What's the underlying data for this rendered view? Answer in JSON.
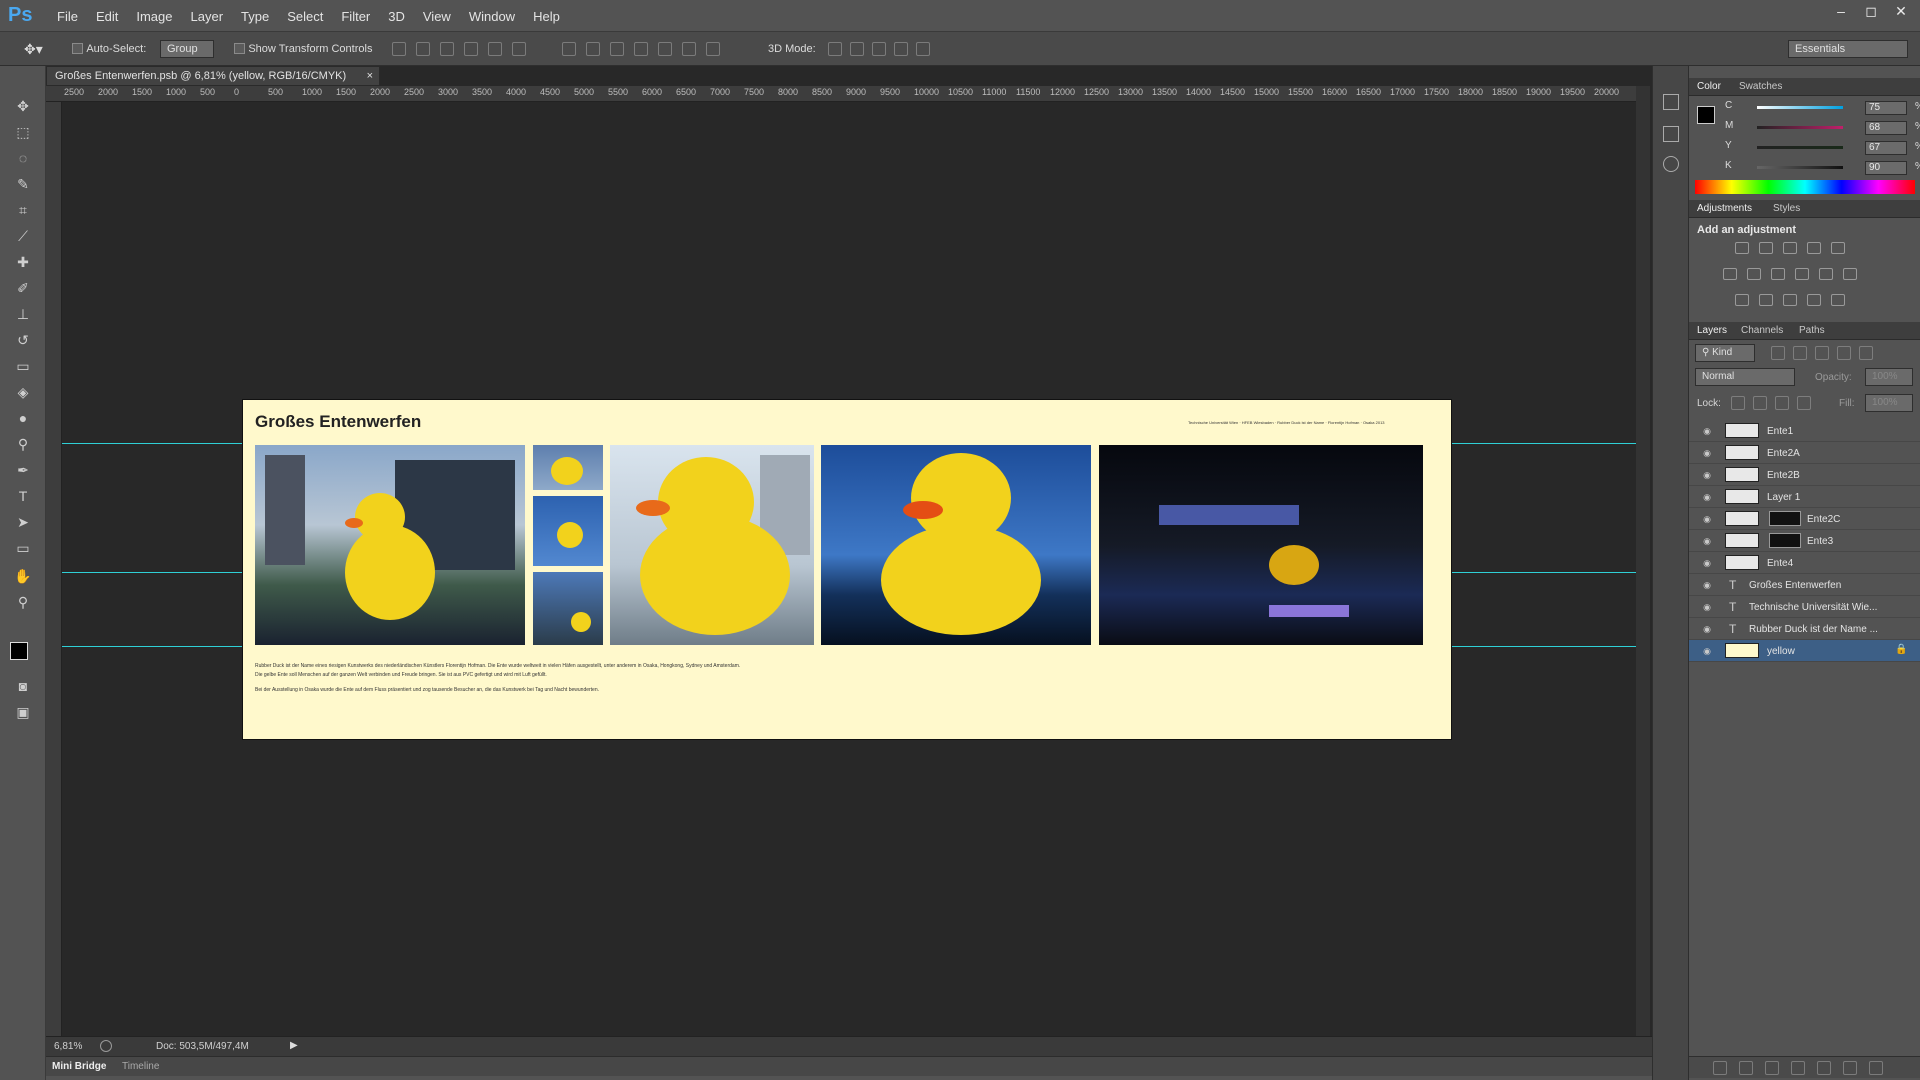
{
  "app": {
    "logo": "Ps"
  },
  "menu": [
    "File",
    "Edit",
    "Image",
    "Layer",
    "Type",
    "Select",
    "Filter",
    "3D",
    "View",
    "Window",
    "Help"
  ],
  "window_controls": {
    "minimize": "–",
    "restore": "◻",
    "close": "✕"
  },
  "options": {
    "auto_select_label": "Auto-Select:",
    "auto_select_value": "Group",
    "show_transform_label": "Show Transform Controls",
    "mode_3d_label": "3D Mode:",
    "workspace": "Essentials"
  },
  "document": {
    "tab_title": "Großes Entenwerfen.psb @ 6,81% (yellow, RGB/16/CMYK)",
    "close": "×",
    "zoom": "6,81%",
    "doc_size": "Doc: 503,5M/497,4M"
  },
  "ruler_ticks": [
    "2500",
    "2000",
    "1500",
    "1000",
    "500",
    "0",
    "500",
    "1000",
    "1500",
    "2000",
    "2500",
    "3000",
    "3500",
    "4000",
    "4500",
    "5000",
    "5500",
    "6000",
    "6500",
    "7000",
    "7500",
    "8000",
    "8500",
    "9000",
    "9500",
    "10000",
    "10500",
    "11000",
    "11500",
    "12000",
    "12500",
    "13000",
    "13500",
    "14000",
    "14500",
    "15000",
    "15500",
    "16000",
    "16500",
    "17000",
    "17500",
    "18000",
    "18500",
    "19000",
    "19500",
    "20000"
  ],
  "canvas": {
    "title": "Großes Entenwerfen",
    "caption_right": "Technische Universität Wien · HFEB Wiesbaden · Rubber Duck ist der Name · Florentijn Hofman · Osaka 2013",
    "body_lines": [
      "Rubber Duck ist der Name eines riesigen Kunstwerks des niederländischen Künstlers Florentijn Hofman. Die Ente wurde weltweit in vielen Häfen ausgestellt, unter anderem in Osaka, Hongkong, Sydney und Amsterdam.",
      "Die gelbe Ente soll Menschen auf der ganzen Welt verbinden und Freude bringen. Sie ist aus PVC gefertigt und wird mit Luft gefüllt.",
      "Bei der Ausstellung in Osaka wurde die Ente auf dem Fluss präsentiert und zog tausende Besucher an, die das Kunstwerk bei Tag und Nacht bewunderten."
    ]
  },
  "bottom_tabs": [
    "Mini Bridge",
    "Timeline"
  ],
  "panels": {
    "color_tabs": [
      "Color",
      "Swatches"
    ],
    "cmyk": [
      {
        "label": "C",
        "value": "75",
        "unit": "%"
      },
      {
        "label": "M",
        "value": "68",
        "unit": "%"
      },
      {
        "label": "Y",
        "value": "67",
        "unit": "%"
      },
      {
        "label": "K",
        "value": "90",
        "unit": "%"
      }
    ],
    "adjust_tabs": [
      "Adjustments",
      "Styles"
    ],
    "adjust_title": "Add an adjustment",
    "layers_tabs": [
      "Layers",
      "Channels",
      "Paths"
    ],
    "filter_kind": "Kind",
    "blend_mode": "Normal",
    "opacity_label": "Opacity:",
    "opacity_value": "100%",
    "lock_label": "Lock:",
    "fill_label": "Fill:",
    "fill_value": "100%",
    "layers": [
      {
        "name": "Ente1"
      },
      {
        "name": "Ente2A"
      },
      {
        "name": "Ente2B"
      },
      {
        "name": "Layer 1"
      },
      {
        "name": "Ente2C"
      },
      {
        "name": "Ente3"
      },
      {
        "name": "Ente4"
      },
      {
        "name": "Großes Entenwerfen"
      },
      {
        "name": "Technische Universität Wie..."
      },
      {
        "name": "Rubber Duck ist der Name ..."
      },
      {
        "name": "yellow"
      }
    ]
  },
  "colors": {
    "accent_guide": "#2fd0d6",
    "canvas_bg": "#fff9cc",
    "selection": "#3d5f86"
  }
}
